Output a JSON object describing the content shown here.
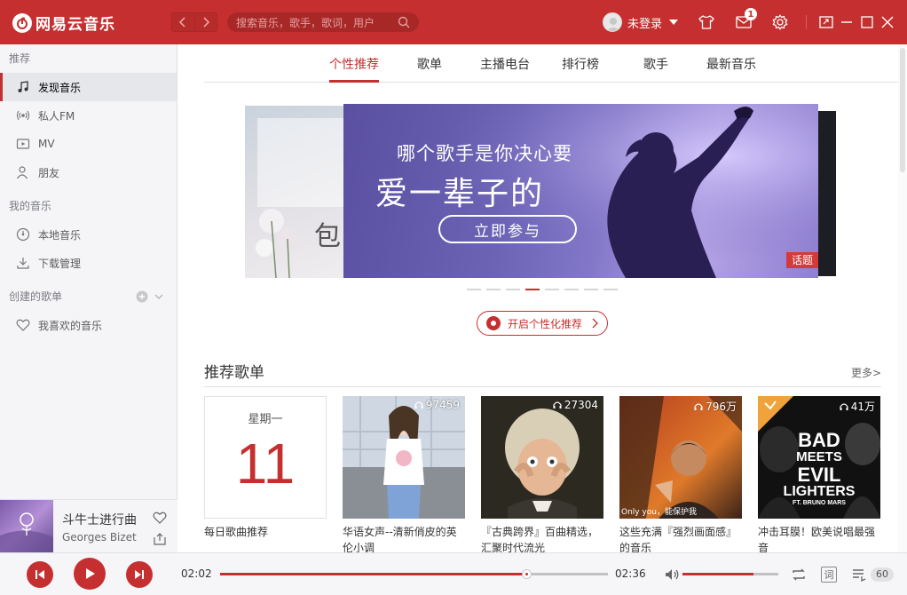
{
  "app": {
    "name": "网易云音乐",
    "brand_color": "#c62f2f"
  },
  "titlebar": {
    "search_placeholder": "搜索音乐，歌手，歌词，用户",
    "user_label": "未登录",
    "mail_badge": "1"
  },
  "sidebar": {
    "section_recommend": "推荐",
    "recommend_items": [
      {
        "label": "发现音乐",
        "icon": "music-note-icon",
        "active": true
      },
      {
        "label": "私人FM",
        "icon": "radio-icon"
      },
      {
        "label": "MV",
        "icon": "video-icon"
      },
      {
        "label": "朋友",
        "icon": "friends-icon"
      }
    ],
    "section_mymusic": "我的音乐",
    "mymusic_items": [
      {
        "label": "本地音乐",
        "icon": "local-music-icon"
      },
      {
        "label": "下载管理",
        "icon": "download-icon"
      }
    ],
    "section_created": "创建的歌单",
    "created_items": [
      {
        "label": "我喜欢的音乐",
        "icon": "heart-icon"
      }
    ]
  },
  "now_playing": {
    "title": "斗牛士进行曲",
    "artist": "Georges Bizet"
  },
  "tabs": [
    "个性推荐",
    "歌单",
    "主播电台",
    "排行榜",
    "歌手",
    "最新音乐"
  ],
  "banner": {
    "line1": "哪个歌手是你决心要",
    "line2": "爱一辈子的",
    "button": "立即参与",
    "tag": "话题",
    "left_partial_text": "包",
    "dot_count": 8,
    "active_dot": 3
  },
  "personal_button": "开启个性化推荐",
  "section": {
    "title": "推荐歌单",
    "more": "更多>"
  },
  "cards": [
    {
      "type": "daily",
      "weekday": "星期一",
      "day": "11",
      "title": "每日歌曲推荐"
    },
    {
      "count": "97459",
      "title": "华语女声--清新俏皮的英伦小调"
    },
    {
      "count": "27304",
      "title": "『古典跨界』百曲精选，汇聚时代流光"
    },
    {
      "count": "796万",
      "title": "这些充满『强烈画面感』的音乐",
      "caption": "Only you，能保护我"
    },
    {
      "count": "41万",
      "title": "冲击耳膜！欧美说唱最强音",
      "cover_text": [
        "BAD",
        "MEETS",
        "EVIL",
        "LIGHTERS",
        "FT. BRUNO MARS"
      ]
    }
  ],
  "player": {
    "current_time": "02:02",
    "total_time": "02:36",
    "progress": 0.79,
    "volume": 0.74,
    "lyrics_label": "词",
    "playlist_count": "60"
  }
}
